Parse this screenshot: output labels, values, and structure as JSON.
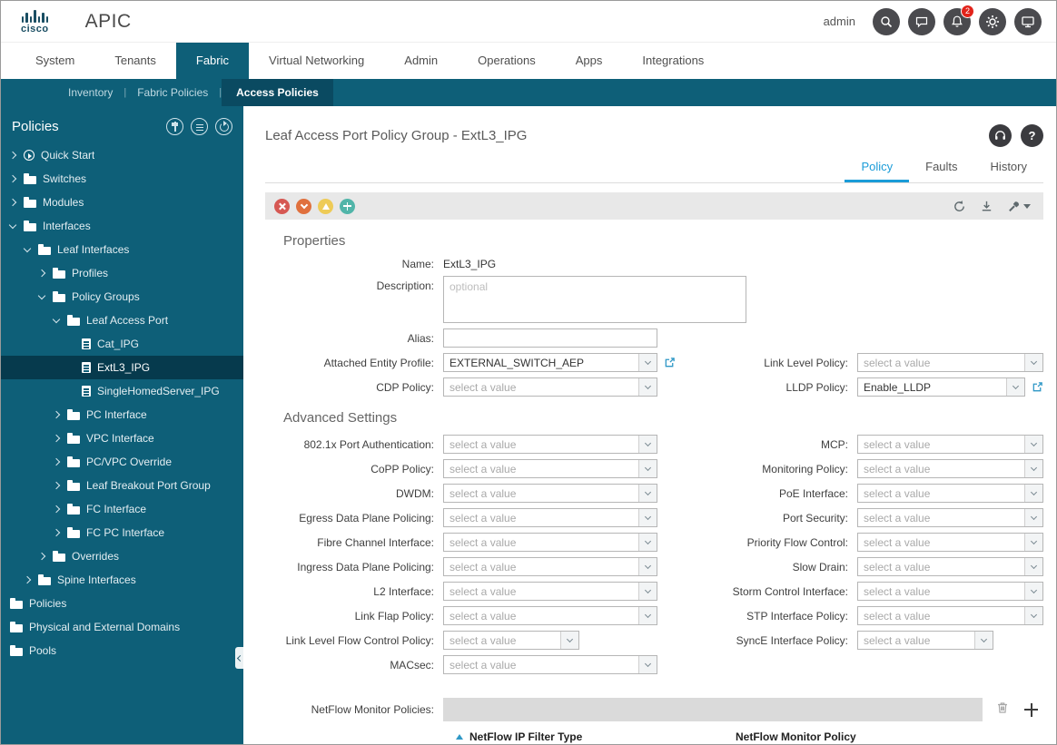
{
  "header": {
    "logo_text": "cisco",
    "app_title": "APIC",
    "username": "admin",
    "notification_badge": "2",
    "icons": [
      "search",
      "feedback",
      "notifications",
      "settings",
      "screen-share"
    ]
  },
  "nav": {
    "active": "Fabric",
    "tabs": [
      {
        "label": "System"
      },
      {
        "label": "Tenants"
      },
      {
        "label": "Fabric"
      },
      {
        "label": "Virtual Networking"
      },
      {
        "label": "Admin"
      },
      {
        "label": "Operations"
      },
      {
        "label": "Apps"
      },
      {
        "label": "Integrations"
      }
    ]
  },
  "subnav": {
    "separator": "|",
    "active": "Access Policies",
    "items": [
      {
        "label": "Inventory"
      },
      {
        "label": "Fabric Policies"
      },
      {
        "label": "Access Policies"
      }
    ]
  },
  "sidebar": {
    "title": "Policies",
    "header_icons": [
      "pin",
      "list",
      "refresh"
    ],
    "tree": [
      {
        "label": "Quick Start",
        "icon": "quick-start",
        "state": "collapsed",
        "depth": 0
      },
      {
        "label": "Switches",
        "icon": "folder",
        "state": "collapsed",
        "depth": 0
      },
      {
        "label": "Modules",
        "icon": "folder",
        "state": "collapsed",
        "depth": 0
      },
      {
        "label": "Interfaces",
        "icon": "folder",
        "state": "expanded",
        "depth": 0
      },
      {
        "label": "Leaf Interfaces",
        "icon": "folder",
        "state": "expanded",
        "depth": 1
      },
      {
        "label": "Profiles",
        "icon": "folder",
        "state": "collapsed",
        "depth": 2
      },
      {
        "label": "Policy Groups",
        "icon": "folder",
        "state": "expanded",
        "depth": 2
      },
      {
        "label": "Leaf Access Port",
        "icon": "folder",
        "state": "expanded",
        "depth": 3
      },
      {
        "label": "Cat_IPG",
        "icon": "document",
        "state": "leaf",
        "depth": 4
      },
      {
        "label": "ExtL3_IPG",
        "icon": "document",
        "state": "leaf",
        "depth": 4,
        "selected": true
      },
      {
        "label": "SingleHomedServer_IPG",
        "icon": "document",
        "state": "leaf",
        "depth": 4
      },
      {
        "label": "PC Interface",
        "icon": "folder",
        "state": "collapsed",
        "depth": 3
      },
      {
        "label": "VPC Interface",
        "icon": "folder",
        "state": "collapsed",
        "depth": 3
      },
      {
        "label": "PC/VPC Override",
        "icon": "folder",
        "state": "collapsed",
        "depth": 3
      },
      {
        "label": "Leaf Breakout Port Group",
        "icon": "folder",
        "state": "collapsed",
        "depth": 3
      },
      {
        "label": "FC Interface",
        "icon": "folder",
        "state": "collapsed",
        "depth": 3
      },
      {
        "label": "FC PC Interface",
        "icon": "folder",
        "state": "collapsed",
        "depth": 3
      },
      {
        "label": "Overrides",
        "icon": "folder",
        "state": "collapsed",
        "depth": 2
      },
      {
        "label": "Spine Interfaces",
        "icon": "folder",
        "state": "collapsed",
        "depth": 1
      },
      {
        "label": "Policies",
        "icon": "folder",
        "state": "none",
        "depth": 0
      },
      {
        "label": "Physical and External Domains",
        "icon": "folder",
        "state": "none",
        "depth": 0
      },
      {
        "label": "Pools",
        "icon": "folder",
        "state": "none",
        "depth": 0
      }
    ]
  },
  "content": {
    "page_title": "Leaf Access Port Policy Group - ExtL3_IPG",
    "header_icons": [
      "headset",
      "help"
    ],
    "active_tab": "Policy",
    "tabs": [
      {
        "label": "Policy"
      },
      {
        "label": "Faults"
      },
      {
        "label": "History"
      }
    ],
    "toolbar": {
      "fault_icons": [
        "critical",
        "major",
        "minor",
        "healthy"
      ],
      "action_icons": [
        "refresh",
        "download",
        "tools"
      ]
    },
    "properties": {
      "heading": "Properties",
      "name": {
        "label": "Name:",
        "value": "ExtL3_IPG"
      },
      "description": {
        "label": "Description:",
        "placeholder": "optional",
        "value": ""
      },
      "alias": {
        "label": "Alias:",
        "value": ""
      },
      "attached_entity_profile": {
        "label": "Attached Entity Profile:",
        "value": "EXTERNAL_SWITCH_AEP"
      },
      "link_level_policy": {
        "label": "Link Level Policy:",
        "value": "select a value"
      },
      "cdp_policy": {
        "label": "CDP Policy:",
        "value": "select a value"
      },
      "lldp_policy": {
        "label": "LLDP Policy:",
        "value": "Enable_LLDP"
      }
    },
    "advanced": {
      "heading": "Advanced Settings",
      "left": [
        {
          "label": "802.1x Port Authentication:",
          "value": "select a value"
        },
        {
          "label": "CoPP Policy:",
          "value": "select a value"
        },
        {
          "label": "DWDM:",
          "value": "select a value"
        },
        {
          "label": "Egress Data Plane Policing:",
          "value": "select a value"
        },
        {
          "label": "Fibre Channel Interface:",
          "value": "select a value"
        },
        {
          "label": "Ingress Data Plane Policing:",
          "value": "select a value"
        },
        {
          "label": "L2 Interface:",
          "value": "select a value"
        },
        {
          "label": "Link Flap Policy:",
          "value": "select a value"
        },
        {
          "label": "Link Level Flow Control Policy:",
          "value": "select a value"
        },
        {
          "label": "MACsec:",
          "value": "select a value"
        }
      ],
      "right": [
        {
          "label": "MCP:",
          "value": "select a value"
        },
        {
          "label": "Monitoring Policy:",
          "value": "select a value"
        },
        {
          "label": "PoE Interface:",
          "value": "select a value"
        },
        {
          "label": "Port Security:",
          "value": "select a value"
        },
        {
          "label": "Priority Flow Control:",
          "value": "select a value"
        },
        {
          "label": "Slow Drain:",
          "value": "select a value"
        },
        {
          "label": "Storm Control Interface:",
          "value": "select a value"
        },
        {
          "label": "STP Interface Policy:",
          "value": "select a value"
        },
        {
          "label": "SyncE Interface Policy:",
          "value": "select a value"
        }
      ]
    },
    "netflow": {
      "label": "NetFlow Monitor Policies:",
      "columns": [
        {
          "label": "NetFlow IP Filter Type"
        },
        {
          "label": "NetFlow Monitor Policy"
        }
      ]
    }
  }
}
